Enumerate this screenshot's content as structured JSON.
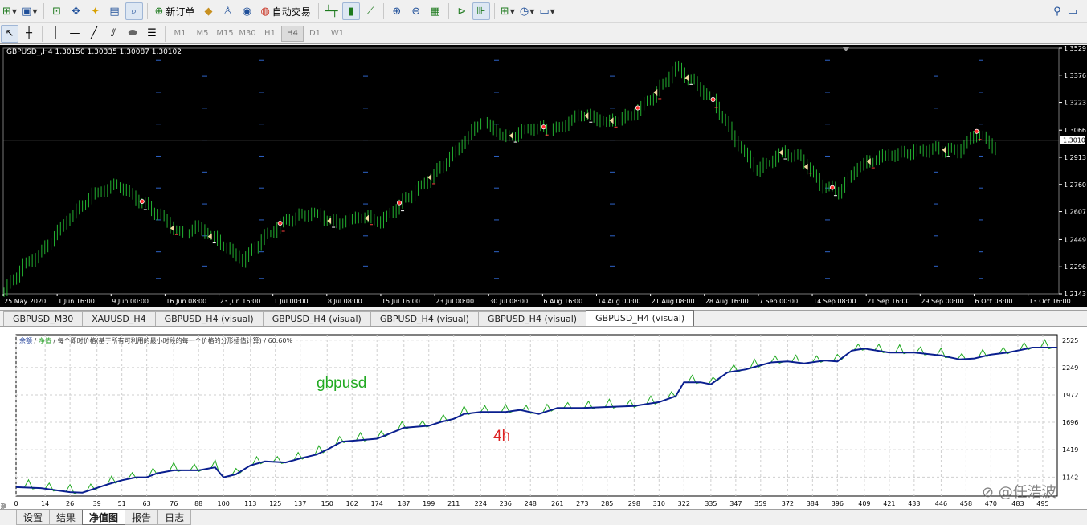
{
  "toolbar": {
    "new_order_label": "新订单",
    "auto_trading_label": "自动交易",
    "timeframes": [
      {
        "label": "M1",
        "active": false
      },
      {
        "label": "M5",
        "active": false
      },
      {
        "label": "M15",
        "active": false
      },
      {
        "label": "M30",
        "active": false
      },
      {
        "label": "H1",
        "active": false
      },
      {
        "label": "H4",
        "active": true
      },
      {
        "label": "D1",
        "active": false
      },
      {
        "label": "W1",
        "active": false
      }
    ]
  },
  "price_chart": {
    "header": "GBPUSD_,H4  1.30150 1.30335 1.30087 1.30102",
    "symbol": "GBPUSD_",
    "period": "H4",
    "current_price": "1.3010",
    "y_axis": {
      "min": 1.2143,
      "max": 1.3529,
      "ticks": [
        "1.3529",
        "1.3376",
        "1.3223",
        "1.3066",
        "1.2913",
        "1.2760",
        "1.2607",
        "1.2449",
        "1.2296",
        "1.2143"
      ]
    },
    "x_labels": [
      "25 May 2020",
      "1 Jun 16:00",
      "9 Jun 00:00",
      "16 Jun 08:00",
      "23 Jun 16:00",
      "1 Jul 00:00",
      "8 Jul 08:00",
      "15 Jul 16:00",
      "23 Jul 00:00",
      "30 Jul 08:00",
      "6 Aug 16:00",
      "14 Aug 00:00",
      "21 Aug 08:00",
      "28 Aug 16:00",
      "7 Sep 00:00",
      "14 Sep 08:00",
      "21 Sep 16:00",
      "29 Sep 00:00",
      "6 Oct 08:00",
      "13 Oct 16:00"
    ],
    "price_path": [
      [
        0,
        1.216
      ],
      [
        3,
        1.23
      ],
      [
        6,
        1.238
      ],
      [
        10,
        1.256
      ],
      [
        14,
        1.27
      ],
      [
        18,
        1.276
      ],
      [
        21,
        1.268
      ],
      [
        25,
        1.258
      ],
      [
        28,
        1.248
      ],
      [
        31,
        1.252
      ],
      [
        34,
        1.244
      ],
      [
        38,
        1.233
      ],
      [
        41,
        1.245
      ],
      [
        45,
        1.256
      ],
      [
        49,
        1.26
      ],
      [
        53,
        1.254
      ],
      [
        57,
        1.258
      ],
      [
        60,
        1.255
      ],
      [
        64,
        1.268
      ],
      [
        68,
        1.28
      ],
      [
        72,
        1.295
      ],
      [
        76,
        1.312
      ],
      [
        80,
        1.302
      ],
      [
        84,
        1.308
      ],
      [
        88,
        1.307
      ],
      [
        92,
        1.316
      ],
      [
        96,
        1.311
      ],
      [
        100,
        1.315
      ],
      [
        104,
        1.328
      ],
      [
        107,
        1.342
      ],
      [
        110,
        1.333
      ],
      [
        113,
        1.323
      ],
      [
        117,
        1.298
      ],
      [
        120,
        1.284
      ],
      [
        124,
        1.294
      ],
      [
        127,
        1.291
      ],
      [
        130,
        1.276
      ],
      [
        133,
        1.272
      ],
      [
        136,
        1.286
      ],
      [
        140,
        1.292
      ],
      [
        144,
        1.294
      ],
      [
        148,
        1.296
      ],
      [
        152,
        1.295
      ],
      [
        155,
        1.305
      ],
      [
        158,
        1.296
      ]
    ],
    "entry_markers": [
      22,
      27,
      33,
      44,
      52,
      58,
      63,
      68,
      81,
      86,
      93,
      97,
      101,
      104,
      109,
      113,
      124,
      128,
      132,
      138,
      150,
      155
    ],
    "colors": {
      "background": "#000000",
      "bars": "#22b030",
      "grid_dash": "#2d63c8",
      "axis": "#ffffff"
    }
  },
  "tabs": [
    {
      "label": "GBPUSD_M30",
      "active": false
    },
    {
      "label": "XAUUSD_H4",
      "active": false
    },
    {
      "label": "GBPUSD_H4 (visual)",
      "active": false
    },
    {
      "label": "GBPUSD_H4 (visual)",
      "active": false
    },
    {
      "label": "GBPUSD_H4 (visual)",
      "active": false
    },
    {
      "label": "GBPUSD_H4 (visual)",
      "active": false
    },
    {
      "label": "GBPUSD_H4 (visual)",
      "active": true
    }
  ],
  "equity_chart": {
    "header_balance": "余额",
    "header_equity": "净值",
    "header_rest": "/ 每个即时价格(基于所有可利用的最小时段的每一个价格的分形插值计算) / 60.60%",
    "annotation_title": "gbpusd",
    "annotation_timeframe": "4h",
    "watermark": "⊘ @任浩波",
    "side_label": "测试器",
    "y_range": [
      950,
      2580
    ],
    "y_ticks": [
      2525,
      2249,
      1972,
      1696,
      1419,
      1142
    ],
    "x_ticks": [
      0,
      14,
      26,
      39,
      51,
      63,
      76,
      88,
      100,
      113,
      125,
      137,
      150,
      162,
      174,
      187,
      199,
      211,
      224,
      236,
      248,
      261,
      273,
      285,
      298,
      310,
      322,
      335,
      347,
      359,
      372,
      384,
      396,
      409,
      421,
      433,
      446,
      458,
      470,
      483,
      495
    ],
    "x_max": 502,
    "balance": [
      [
        0,
        1040
      ],
      [
        12,
        1030
      ],
      [
        26,
        990
      ],
      [
        32,
        985
      ],
      [
        40,
        1040
      ],
      [
        46,
        1080
      ],
      [
        51,
        1110
      ],
      [
        58,
        1140
      ],
      [
        63,
        1140
      ],
      [
        68,
        1180
      ],
      [
        76,
        1210
      ],
      [
        88,
        1210
      ],
      [
        96,
        1240
      ],
      [
        100,
        1140
      ],
      [
        106,
        1170
      ],
      [
        113,
        1260
      ],
      [
        120,
        1300
      ],
      [
        130,
        1290
      ],
      [
        137,
        1330
      ],
      [
        145,
        1370
      ],
      [
        150,
        1420
      ],
      [
        157,
        1500
      ],
      [
        174,
        1530
      ],
      [
        180,
        1580
      ],
      [
        187,
        1640
      ],
      [
        199,
        1660
      ],
      [
        205,
        1700
      ],
      [
        211,
        1730
      ],
      [
        216,
        1780
      ],
      [
        224,
        1800
      ],
      [
        236,
        1800
      ],
      [
        243,
        1820
      ],
      [
        252,
        1780
      ],
      [
        261,
        1840
      ],
      [
        273,
        1840
      ],
      [
        285,
        1850
      ],
      [
        298,
        1860
      ],
      [
        310,
        1900
      ],
      [
        318,
        1960
      ],
      [
        322,
        2100
      ],
      [
        330,
        2100
      ],
      [
        335,
        2080
      ],
      [
        343,
        2200
      ],
      [
        352,
        2230
      ],
      [
        357,
        2260
      ],
      [
        364,
        2300
      ],
      [
        372,
        2310
      ],
      [
        380,
        2290
      ],
      [
        390,
        2320
      ],
      [
        396,
        2310
      ],
      [
        403,
        2420
      ],
      [
        409,
        2440
      ],
      [
        421,
        2400
      ],
      [
        433,
        2400
      ],
      [
        446,
        2370
      ],
      [
        455,
        2330
      ],
      [
        462,
        2340
      ],
      [
        470,
        2380
      ],
      [
        478,
        2400
      ],
      [
        483,
        2420
      ],
      [
        490,
        2450
      ],
      [
        502,
        2450
      ]
    ],
    "colors": {
      "balance": "#0a1f8f",
      "equity": "#22aa22",
      "grid": "#cfcfcf"
    }
  },
  "bottom_tabs": [
    {
      "label": "设置",
      "active": false
    },
    {
      "label": "结果",
      "active": false
    },
    {
      "label": "净值图",
      "active": true
    },
    {
      "label": "报告",
      "active": false
    },
    {
      "label": "日志",
      "active": false
    }
  ]
}
